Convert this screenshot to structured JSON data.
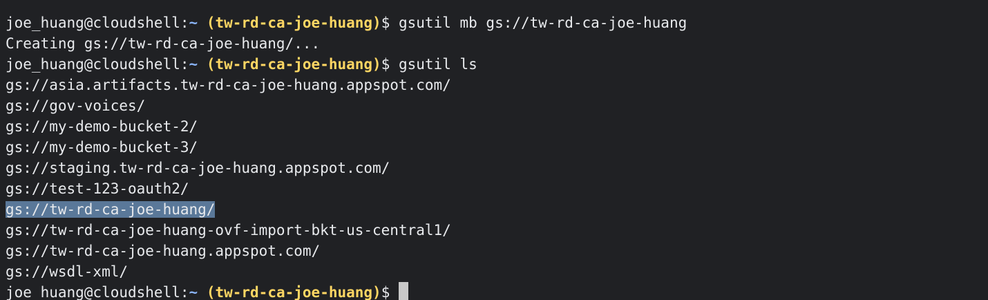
{
  "terminal": {
    "prompt": {
      "user_host": "joe_huang@cloudshell:",
      "tilde": "~",
      "project": "(tw-rd-ca-joe-huang)",
      "dollar": "$"
    },
    "commands": {
      "mb": " gsutil mb gs://tw-rd-ca-joe-huang",
      "ls": " gsutil ls"
    },
    "creating_output": "Creating gs://tw-rd-ca-joe-huang/...",
    "bucket_list": [
      "gs://asia.artifacts.tw-rd-ca-joe-huang.appspot.com/",
      "gs://gov-voices/",
      "gs://my-demo-bucket-2/",
      "gs://my-demo-bucket-3/",
      "gs://staging.tw-rd-ca-joe-huang.appspot.com/",
      "gs://test-123-oauth2/",
      "gs://tw-rd-ca-joe-huang/",
      "gs://tw-rd-ca-joe-huang-ovf-import-bkt-us-central1/",
      "gs://tw-rd-ca-joe-huang.appspot.com/",
      "gs://wsdl-xml/"
    ],
    "selected_bucket_index": 6,
    "colors": {
      "background": "#202124",
      "text": "#e8eaed",
      "tilde": "#8ab4f8",
      "project": "#fdd663",
      "selection": "#5a7899",
      "cursor": "#c8c8c8"
    }
  }
}
